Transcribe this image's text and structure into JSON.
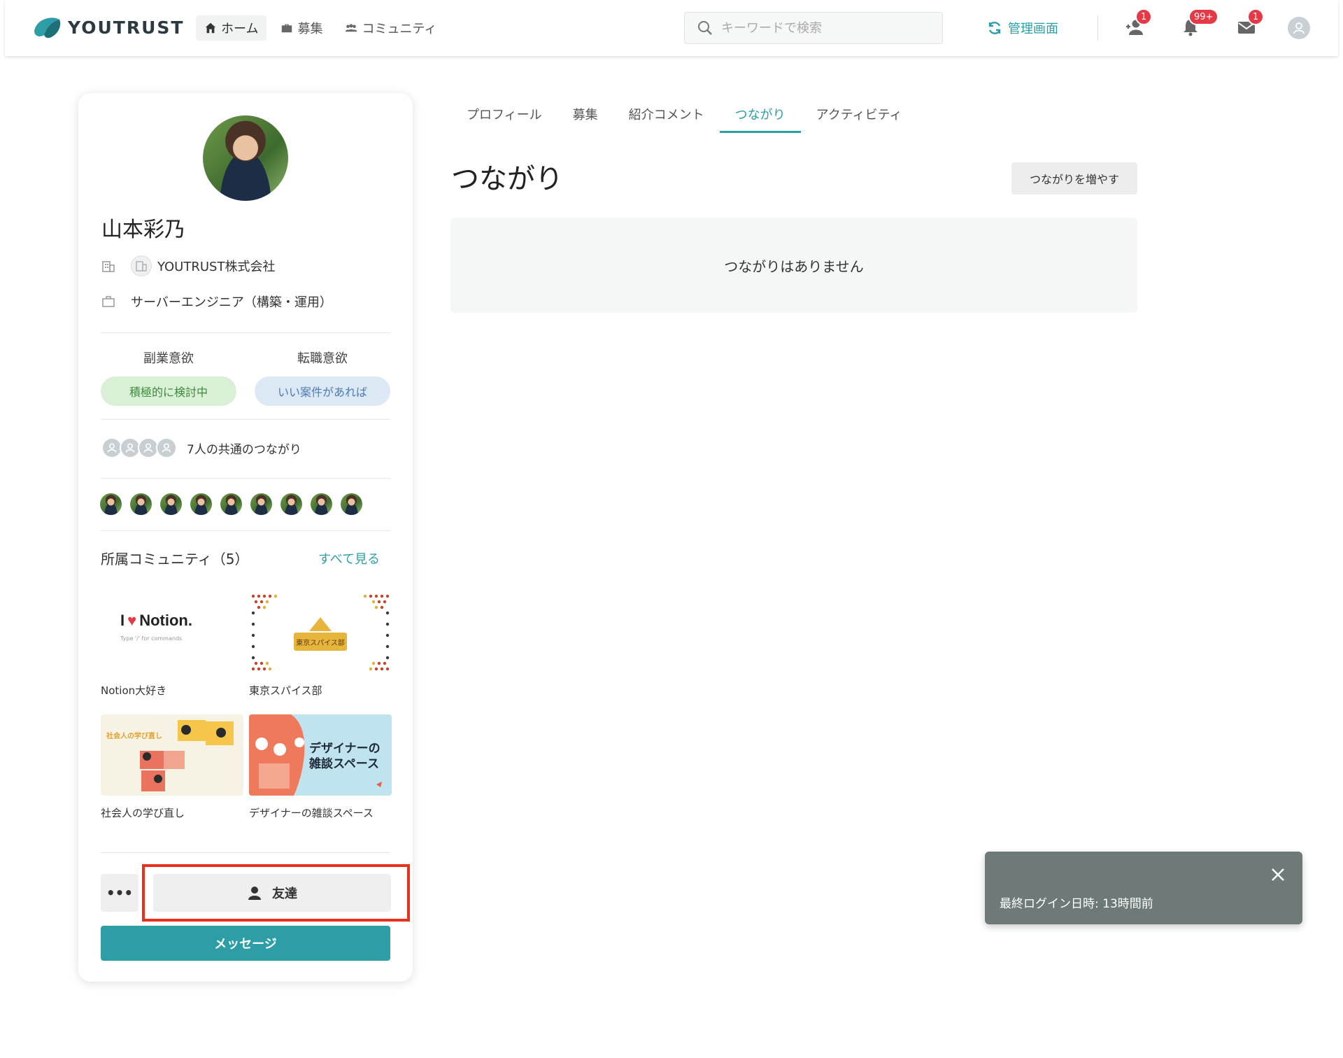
{
  "header": {
    "logo_text": "YOUTRUST",
    "nav": [
      {
        "label": "ホーム",
        "icon": "home-icon",
        "active": true
      },
      {
        "label": "募集",
        "icon": "briefcase-icon",
        "active": false
      },
      {
        "label": "コミュニティ",
        "icon": "community-icon",
        "active": false
      }
    ],
    "search_placeholder": "キーワードで検索",
    "admin_label": "管理画面",
    "badges": {
      "friend_requests": "1",
      "notifications": "99+",
      "messages": "1"
    }
  },
  "profile": {
    "name": "山本彩乃",
    "company": "YOUTRUST株式会社",
    "job": "サーバーエンジニア（構築・運用）",
    "side_job_label": "副業意欲",
    "side_job_value": "積極的に検討中",
    "job_change_label": "転職意欲",
    "job_change_value": "いい案件があれば",
    "mutual_text": "7人の共通のつながり",
    "communities_title": "所属コミュニティ（5）",
    "see_all": "すべて見る",
    "communities": [
      {
        "label": "Notion大好き",
        "image_text": "Notion.",
        "image_subtext": "Type '/' for commands"
      },
      {
        "label": "東京スパイス部",
        "image_text": "東京スパイス部"
      },
      {
        "label": "社会人の学び直し",
        "image_text": "社会人の学び直し"
      },
      {
        "label": "デザイナーの雑談スペース",
        "image_text_1": "デザイナーの",
        "image_text_2": "雑談スペース"
      }
    ],
    "more_label": "•••",
    "friend_button": "友達",
    "message_button": "メッセージ"
  },
  "main": {
    "tabs": [
      {
        "label": "プロフィール",
        "active": false
      },
      {
        "label": "募集",
        "active": false
      },
      {
        "label": "紹介コメント",
        "active": false
      },
      {
        "label": "つながり",
        "active": true
      },
      {
        "label": "アクティビティ",
        "active": false
      }
    ],
    "title": "つながり",
    "grow_button": "つながりを増やす",
    "empty_message": "つながりはありません"
  },
  "toast": {
    "text": "最終ログイン日時: 13時間前"
  },
  "colors": {
    "accent": "#2b9ea8",
    "highlight": "#e8321c",
    "badge": "#e63946"
  }
}
